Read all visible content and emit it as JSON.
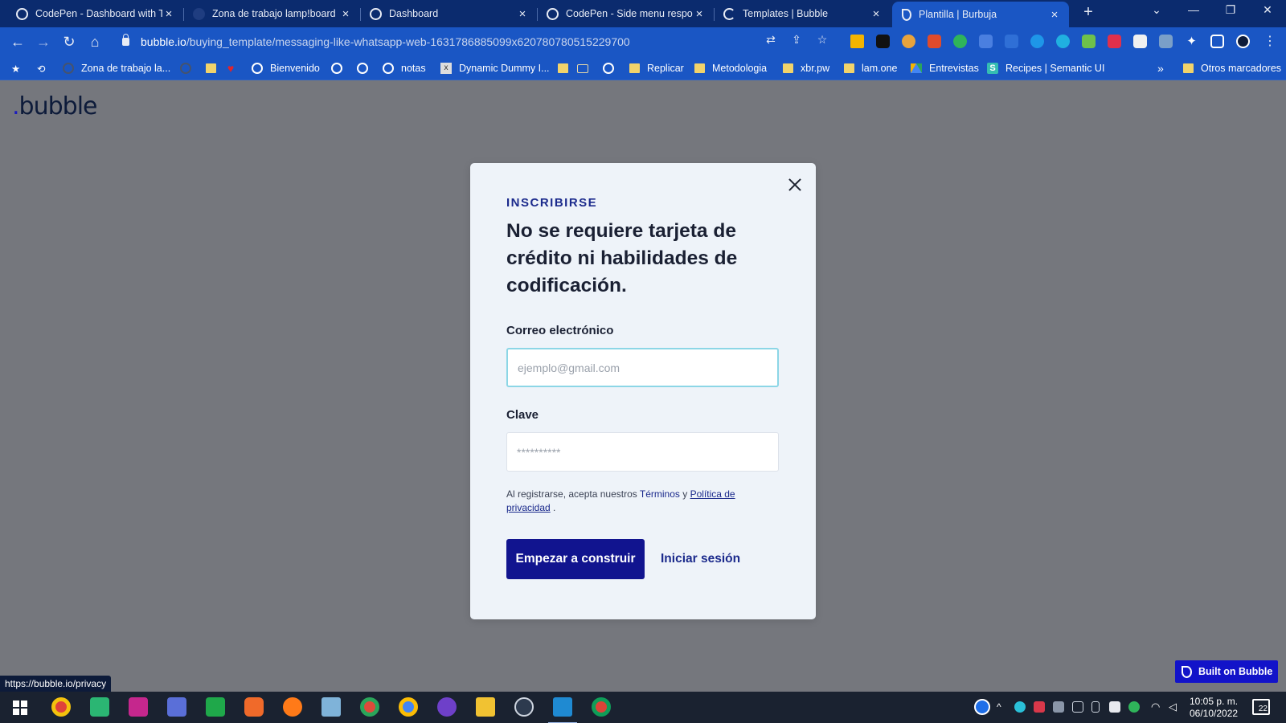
{
  "browser": {
    "tabs": [
      {
        "label": "CodePen - Dashboard with Ta",
        "close": "×"
      },
      {
        "label": "Zona de trabajo lamp!board",
        "close": "×"
      },
      {
        "label": "Dashboard",
        "close": "×"
      },
      {
        "label": "CodePen - Side menu respon",
        "close": "×"
      },
      {
        "label": "Templates | Bubble",
        "close": "×"
      },
      {
        "label": "Plantilla | Burbuja",
        "close": "×"
      }
    ],
    "new_tab": "+",
    "window_controls": {
      "menu": "⌄",
      "minimize": "—",
      "restore": "❐",
      "close": "✕"
    },
    "nav": {
      "back": "←",
      "forward": "→",
      "reload": "↻",
      "home": "⌂"
    },
    "url_host": "bubble.io",
    "url_path": "/buying_template/messaging-like-whatsapp-web-1631786885099x620780780515229700",
    "bookmarks": [
      {
        "label": "Zona de trabajo la...",
        "icon": "globe"
      },
      {
        "label": "Bienvenido",
        "icon": "globe"
      },
      {
        "label": "notas",
        "icon": "globe"
      },
      {
        "label": "Dynamic Dummy I...",
        "icon": "x-favicon"
      },
      {
        "label": "Replicar",
        "icon": "folder"
      },
      {
        "label": "Metodologia",
        "icon": "folder"
      },
      {
        "label": "xbr.pw",
        "icon": "folder"
      },
      {
        "label": "lam.one",
        "icon": "folder"
      },
      {
        "label": "Entrevistas",
        "icon": "drive"
      },
      {
        "label": "Recipes | Semantic UI",
        "icon": "semantic"
      }
    ],
    "bookmarks_overflow": "»",
    "other_bookmarks": "Otros marcadores"
  },
  "page": {
    "logo": "bubble",
    "modal": {
      "eyebrow": "INSCRIBIRSE",
      "heading": "No se requiere tarjeta de crédito ni habilidades de codificación.",
      "email_label": "Correo electrónico",
      "email_placeholder": "ejemplo@gmail.com",
      "email_value": "",
      "password_label": "Clave",
      "password_placeholder": "**********",
      "password_value": "",
      "legal_prefix": "Al registrarse, acepta nuestros ",
      "legal_terms": "Términos",
      "legal_and": " y ",
      "legal_privacy": "Política de privacidad",
      "legal_suffix": " .",
      "cta": "Empezar a construir",
      "login": "Iniciar sesión"
    },
    "status_url": "https://bubble.io/privacy",
    "built_on": "Built on Bubble"
  },
  "taskbar": {
    "time": "10:05 p. m.",
    "date": "06/10/2022",
    "notifications": "22"
  }
}
